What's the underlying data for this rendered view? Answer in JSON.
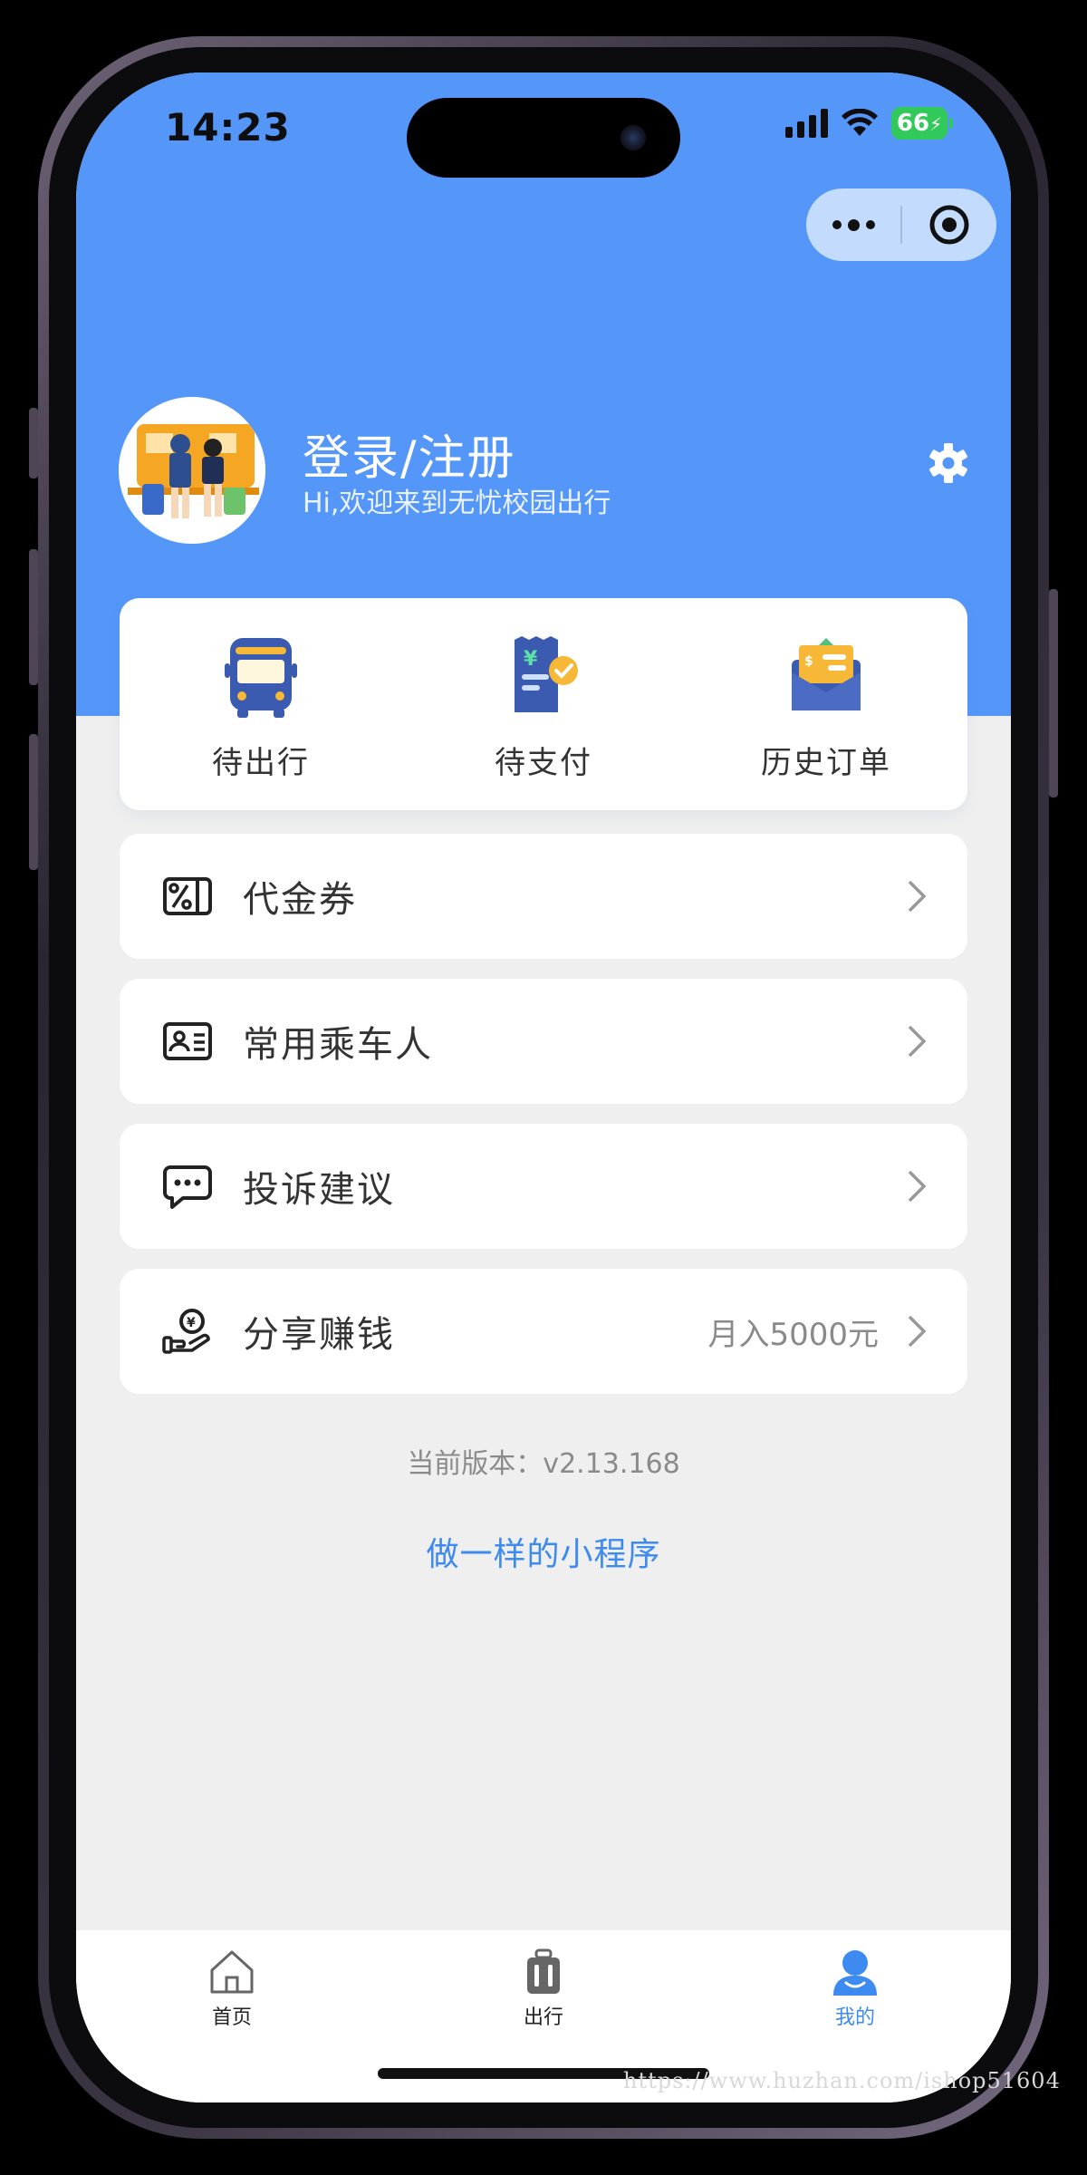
{
  "status_bar": {
    "time": "14:23",
    "battery": "66"
  },
  "capsule": {
    "more_icon": "more-dots-icon",
    "close_icon": "target-circle-icon"
  },
  "profile": {
    "title": "登录/注册",
    "welcome": "Hi,欢迎来到无忧校园出行"
  },
  "orders": [
    {
      "label": "待出行",
      "icon": "bus-icon"
    },
    {
      "label": "待支付",
      "icon": "receipt-icon"
    },
    {
      "label": "历史订单",
      "icon": "envelope-icon"
    }
  ],
  "menu": [
    {
      "label": "代金券",
      "icon": "coupon-icon",
      "extra": ""
    },
    {
      "label": "常用乘车人",
      "icon": "id-card-icon",
      "extra": ""
    },
    {
      "label": "投诉建议",
      "icon": "chat-bubble-icon",
      "extra": ""
    },
    {
      "label": "分享赚钱",
      "icon": "hand-coin-icon",
      "extra": "月入5000元"
    }
  ],
  "version": "当前版本：v2.13.168",
  "promo_link": "做一样的小程序",
  "tabs": [
    {
      "label": "首页",
      "icon": "home-icon",
      "active": false
    },
    {
      "label": "出行",
      "icon": "luggage-icon",
      "active": false
    },
    {
      "label": "我的",
      "icon": "user-icon",
      "active": true
    }
  ],
  "watermark": "https://www.huzhan.com/ishop51604",
  "colors": {
    "header_blue": "#5497f9",
    "accent_blue": "#3d8af0",
    "background": "#efefef",
    "battery_green": "#31c95a"
  }
}
